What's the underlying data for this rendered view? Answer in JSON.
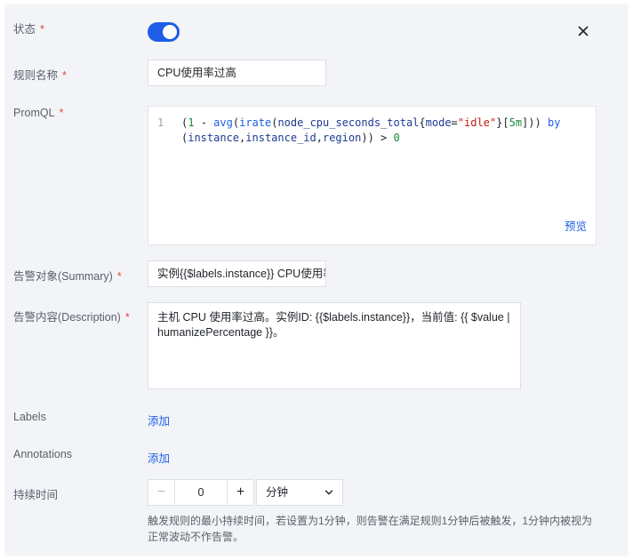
{
  "form": {
    "status": {
      "label": "状态",
      "required_mark": "*",
      "enabled": true
    },
    "rule_name": {
      "label": "规则名称",
      "required_mark": "*",
      "value": "CPU使用率过高"
    },
    "promql": {
      "label": "PromQL",
      "required_mark": "*",
      "line_number": "1",
      "code": "(1 - avg(irate(node_cpu_seconds_total{mode=\"idle\"}[5m])) by (instance,instance_id,region)) > 0",
      "preview_label": "预览"
    },
    "summary": {
      "label": "告警对象(Summary)",
      "required_mark": "*",
      "value": "实例{{$labels.instance}} CPU使用率过高"
    },
    "description": {
      "label": "告警内容(Description)",
      "required_mark": "*",
      "value": "主机 CPU 使用率过高。实例ID: {{$labels.instance}}，当前值: {{ $value | humanizePercentage }}。"
    },
    "labels": {
      "label": "Labels",
      "add_label": "添加"
    },
    "annotations": {
      "label": "Annotations",
      "add_label": "添加"
    },
    "duration": {
      "label": "持续时间",
      "minus": "−",
      "plus": "+",
      "value": "0",
      "unit": "分钟",
      "help": "触发规则的最小持续时间，若设置为1分钟，则告警在满足规则1分钟后被触发，1分钟内被视为正常波动不作告警。"
    }
  },
  "icons": {
    "close": "close-icon",
    "dropdown": "chevron-down-icon"
  },
  "colors": {
    "accent": "#1d5ee8",
    "required": "#e54545",
    "background": "#f3f4f7"
  }
}
